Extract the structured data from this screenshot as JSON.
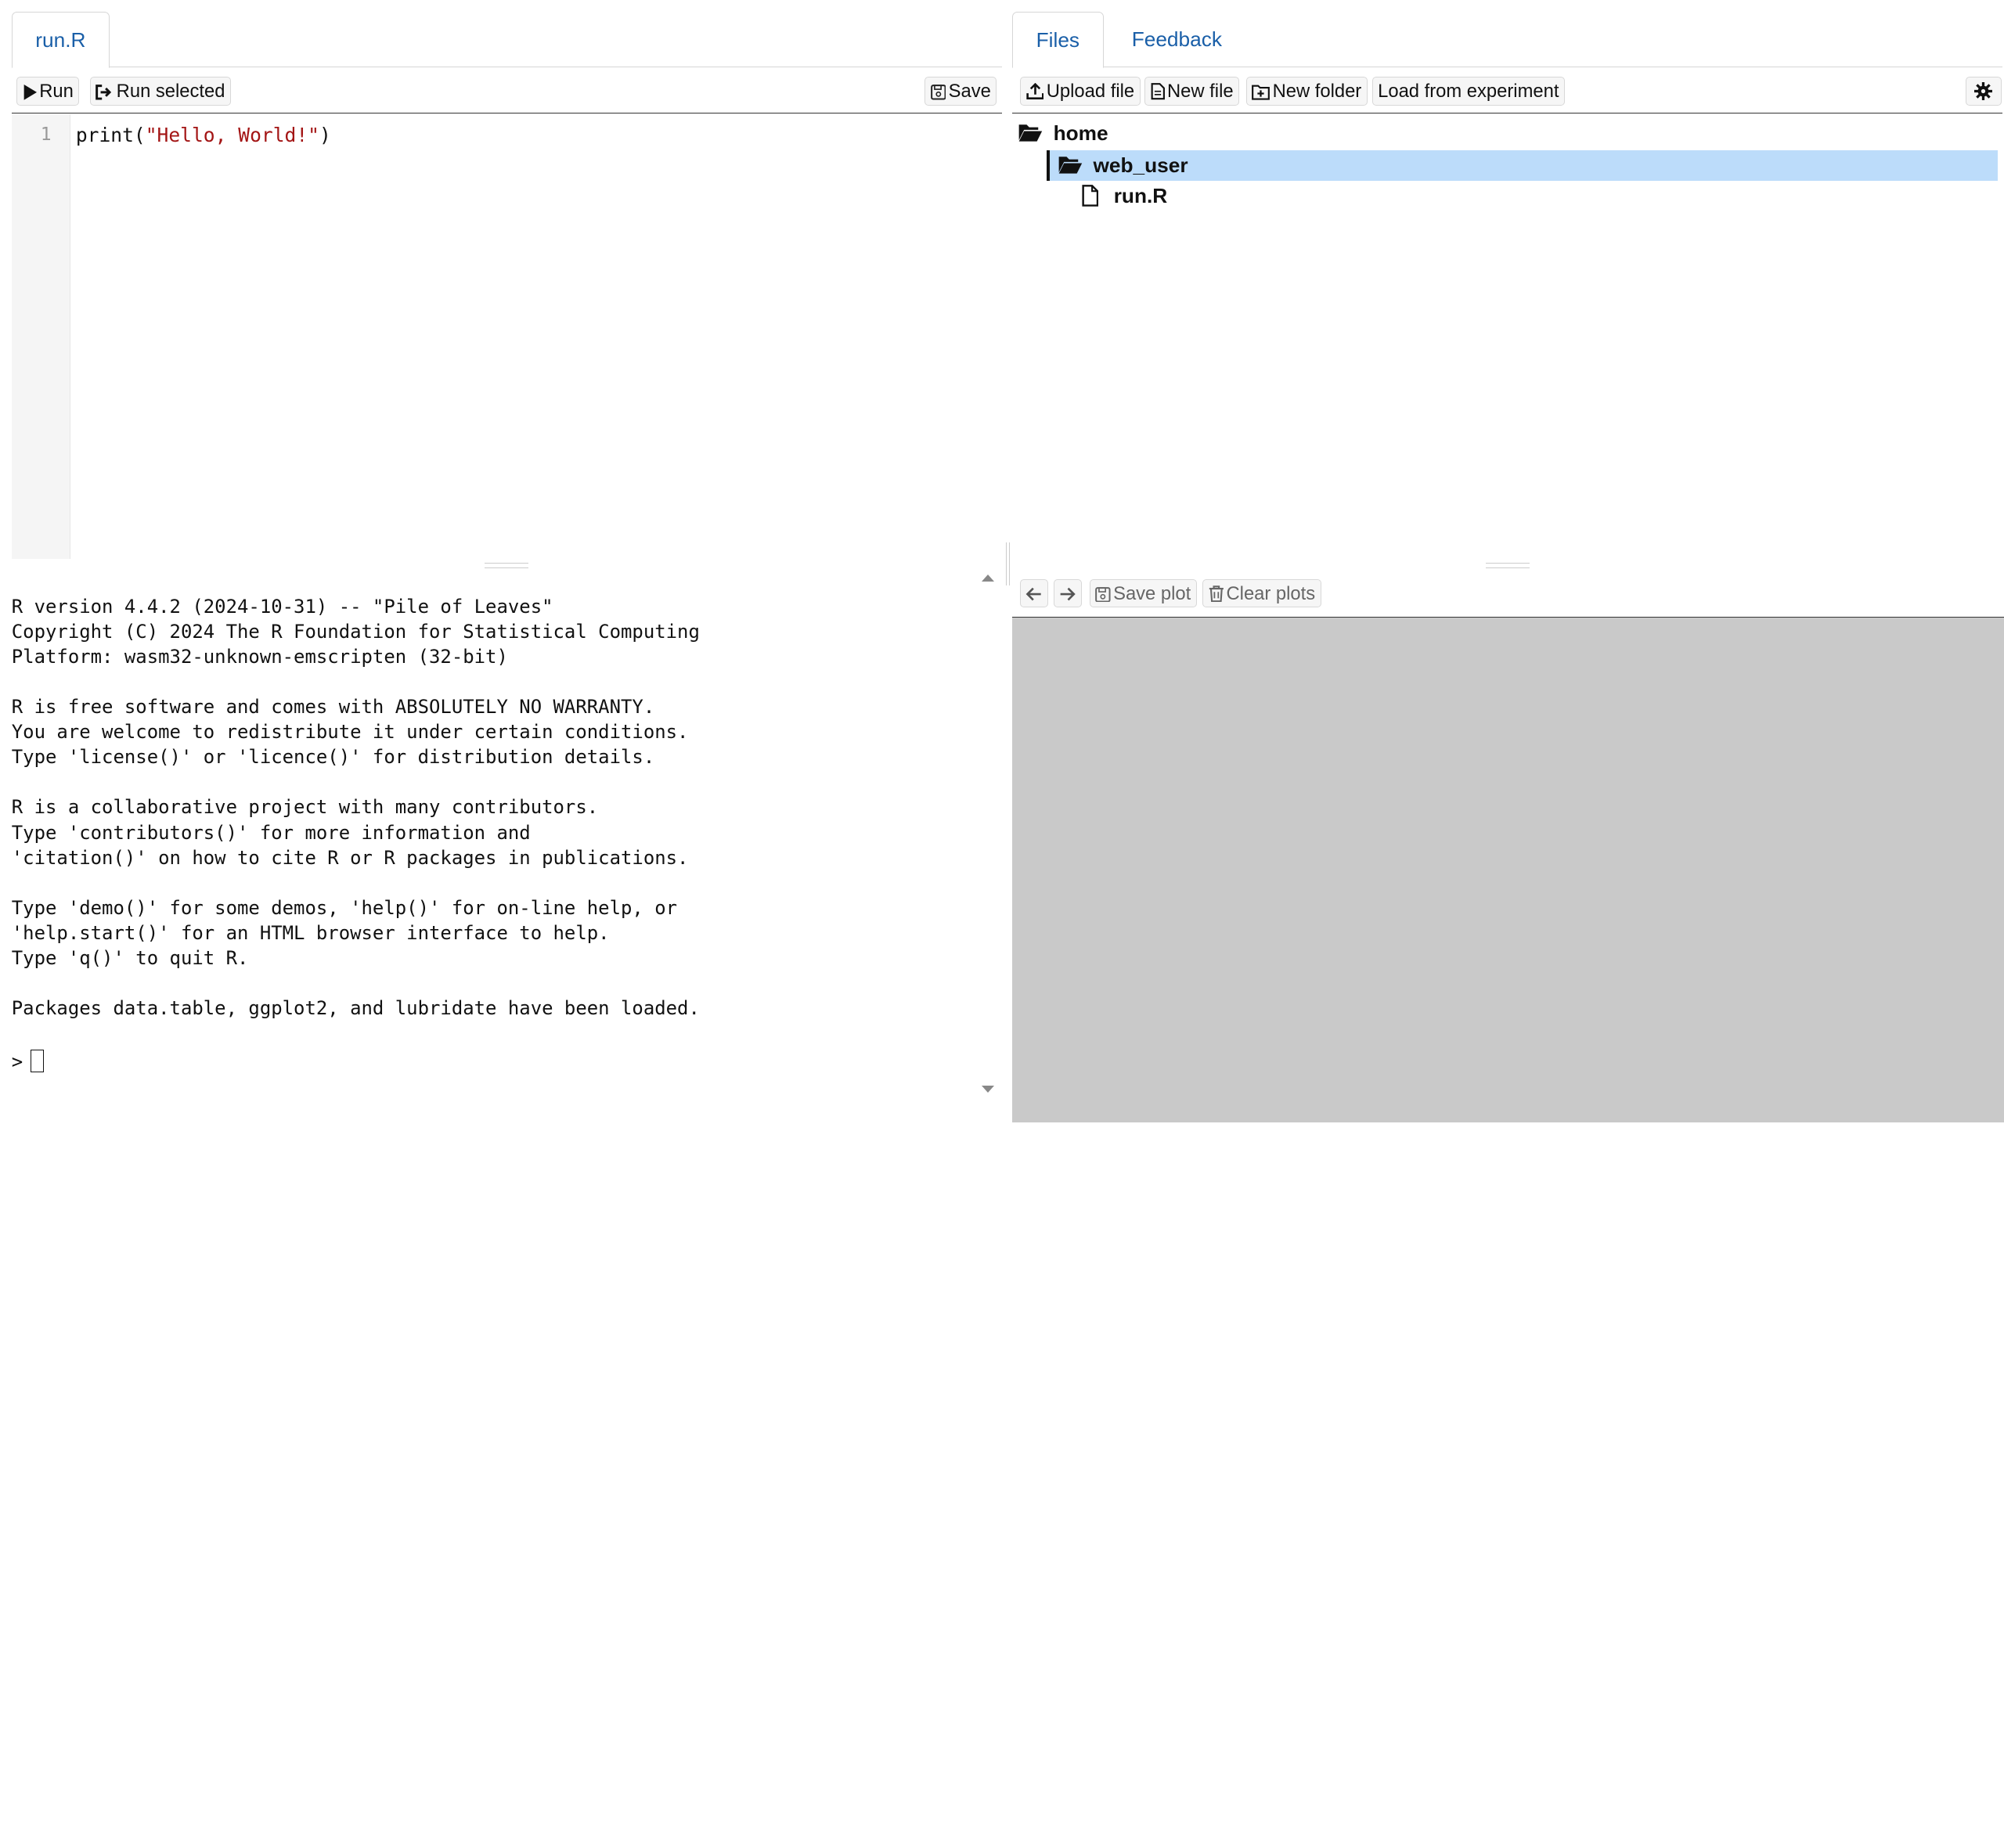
{
  "editor": {
    "tab_label": "run.R",
    "toolbar": {
      "run_label": "Run",
      "run_selected_label": "Run selected",
      "save_label": "Save"
    },
    "line_number": "1",
    "code": {
      "func": "print(",
      "string": "\"Hello, World!\"",
      "close": ")"
    }
  },
  "console": {
    "lines": [
      "R version 4.4.2 (2024-10-31) -- \"Pile of Leaves\"",
      "Copyright (C) 2024 The R Foundation for Statistical Computing",
      "Platform: wasm32-unknown-emscripten (32-bit)",
      "",
      "R is free software and comes with ABSOLUTELY NO WARRANTY.",
      "You are welcome to redistribute it under certain conditions.",
      "Type 'license()' or 'licence()' for distribution details.",
      "",
      "R is a collaborative project with many contributors.",
      "Type 'contributors()' for more information and",
      "'citation()' on how to cite R or R packages in publications.",
      "",
      "Type 'demo()' for some demos, 'help()' for on-line help, or",
      "'help.start()' for an HTML browser interface to help.",
      "Type 'q()' to quit R.",
      "",
      "Packages data.table, ggplot2, and lubridate have been loaded.",
      ""
    ],
    "prompt": ">"
  },
  "files_panel": {
    "tabs": [
      {
        "label": "Files",
        "active": true
      },
      {
        "label": "Feedback",
        "active": false
      }
    ],
    "toolbar": {
      "upload_label": "Upload file",
      "new_file_label": "New file",
      "new_folder_label": "New folder",
      "load_label": "Load from experiment"
    },
    "tree": {
      "root": "home",
      "folder": "web_user",
      "file": "run.R"
    }
  },
  "plot_panel": {
    "save_plot_label": "Save plot",
    "clear_plots_label": "Clear plots"
  },
  "colors": {
    "accent": "#1a5fa8",
    "selection": "#bcdcfa",
    "plot_background": "#c9c9c9",
    "string": "#a31515"
  }
}
